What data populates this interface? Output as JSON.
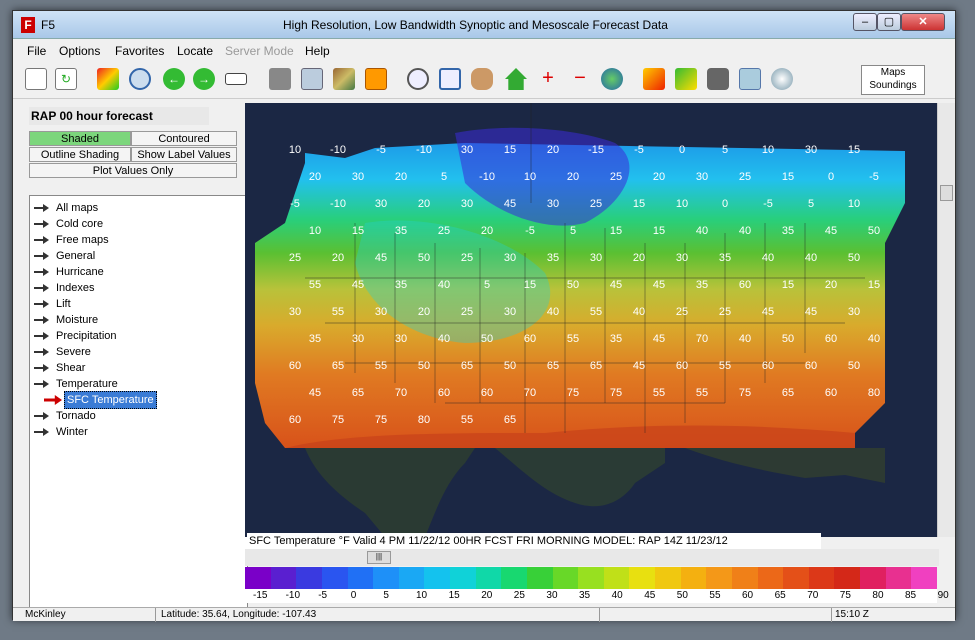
{
  "window": {
    "app_name": "F5",
    "title": "High Resolution, Low Bandwidth Synoptic and Mesoscale Forecast Data",
    "watermark": "SOFTPEDIA"
  },
  "menu": [
    "File",
    "Options",
    "Favorites",
    "Locate",
    "Server Mode",
    "Help"
  ],
  "toolbar_icons": [
    "new-document",
    "refresh",
    "radar-image",
    "clock",
    "back",
    "forward",
    "frames",
    "sat-image",
    "copy-pages",
    "terrain",
    "stack",
    "zoom-in",
    "zoom-rect",
    "pan-hand",
    "home",
    "zoom-plus",
    "zoom-minus",
    "globe",
    "ruler",
    "lightning",
    "satellite",
    "calculator",
    "hurricane"
  ],
  "maps_toggle": {
    "line1": "Maps",
    "line2": "Soundings"
  },
  "panel": {
    "forecast_title": "RAP 00 hour forecast",
    "shaded": "Shaded",
    "contoured": "Contoured",
    "outline_shading": "Outline Shading",
    "show_label_values": "Show Label Values",
    "plot_values_only": "Plot Values Only"
  },
  "tree": {
    "items": [
      "All maps",
      "Cold core",
      "Free maps",
      "General",
      "Hurricane",
      "Indexes",
      "Lift",
      "Moisture",
      "Precipitation",
      "Severe",
      "Shear",
      "Temperature",
      "Tornado",
      "Winter"
    ],
    "selected_child": "SFC Temperature"
  },
  "map": {
    "caption": "SFC Temperature  °F    Valid 4 PM  11/22/12 00HR FCST  FRI MORNING     MODEL: RAP 14Z 11/23/12",
    "values": [
      "10",
      "-10",
      "-5",
      "-10",
      "30",
      "15",
      "20",
      "-15",
      "-5",
      "0",
      "5",
      "10",
      "30",
      "15",
      "20",
      "30",
      "20",
      "5",
      "-10",
      "10",
      "20",
      "25",
      "20",
      "30",
      "25",
      "15",
      "0",
      "-5",
      "-5",
      "-10",
      "30",
      "20",
      "30",
      "45",
      "30",
      "25",
      "15",
      "10",
      "0",
      "-5",
      "5",
      "10",
      "10",
      "15",
      "35",
      "25",
      "20",
      "-5",
      "5",
      "15",
      "15",
      "40",
      "40",
      "35",
      "45",
      "50",
      "25",
      "20",
      "45",
      "50",
      "25",
      "30",
      "35",
      "30",
      "20",
      "30",
      "35",
      "40",
      "40",
      "50",
      "55",
      "45",
      "35",
      "40",
      "5",
      "15",
      "50",
      "45",
      "45",
      "35",
      "60",
      "15",
      "20",
      "15",
      "30",
      "55",
      "30",
      "20",
      "25",
      "30",
      "40",
      "55",
      "40",
      "25",
      "25",
      "45",
      "45",
      "30",
      "35",
      "30",
      "30",
      "40",
      "50",
      "60",
      "55",
      "35",
      "45",
      "70",
      "40",
      "50",
      "60",
      "40",
      "60",
      "65",
      "55",
      "50",
      "65",
      "50",
      "65",
      "65",
      "45",
      "60",
      "55",
      "60",
      "60",
      "50",
      "45",
      "65",
      "70",
      "60",
      "60",
      "70",
      "75",
      "75",
      "55",
      "55",
      "75",
      "65",
      "60",
      "80",
      "60",
      "75",
      "75",
      "80",
      "55",
      "65"
    ]
  },
  "legend": {
    "labels": [
      "-15",
      "-10",
      "-5",
      "0",
      "5",
      "10",
      "15",
      "20",
      "25",
      "30",
      "35",
      "40",
      "45",
      "50",
      "55",
      "60",
      "65",
      "70",
      "75",
      "80",
      "85",
      "90"
    ],
    "colors": [
      "#7a00c8",
      "#5a1fd0",
      "#3a3ae0",
      "#2a55f0",
      "#2070f5",
      "#1e90f8",
      "#1aa8f4",
      "#14c2ee",
      "#10d2d8",
      "#10d8a8",
      "#18d870",
      "#38d038",
      "#68d828",
      "#98e020",
      "#c0e018",
      "#e8e010",
      "#f0c810",
      "#f4b010",
      "#f49818",
      "#f08018",
      "#ec6818",
      "#e45018",
      "#dc3818",
      "#d42818",
      "#e02060",
      "#e83090",
      "#f040c0"
    ]
  },
  "status": {
    "place": "McKinley",
    "coords": "Latitude: 35.64, Longitude: -107.43",
    "time": "15:10 Z"
  }
}
